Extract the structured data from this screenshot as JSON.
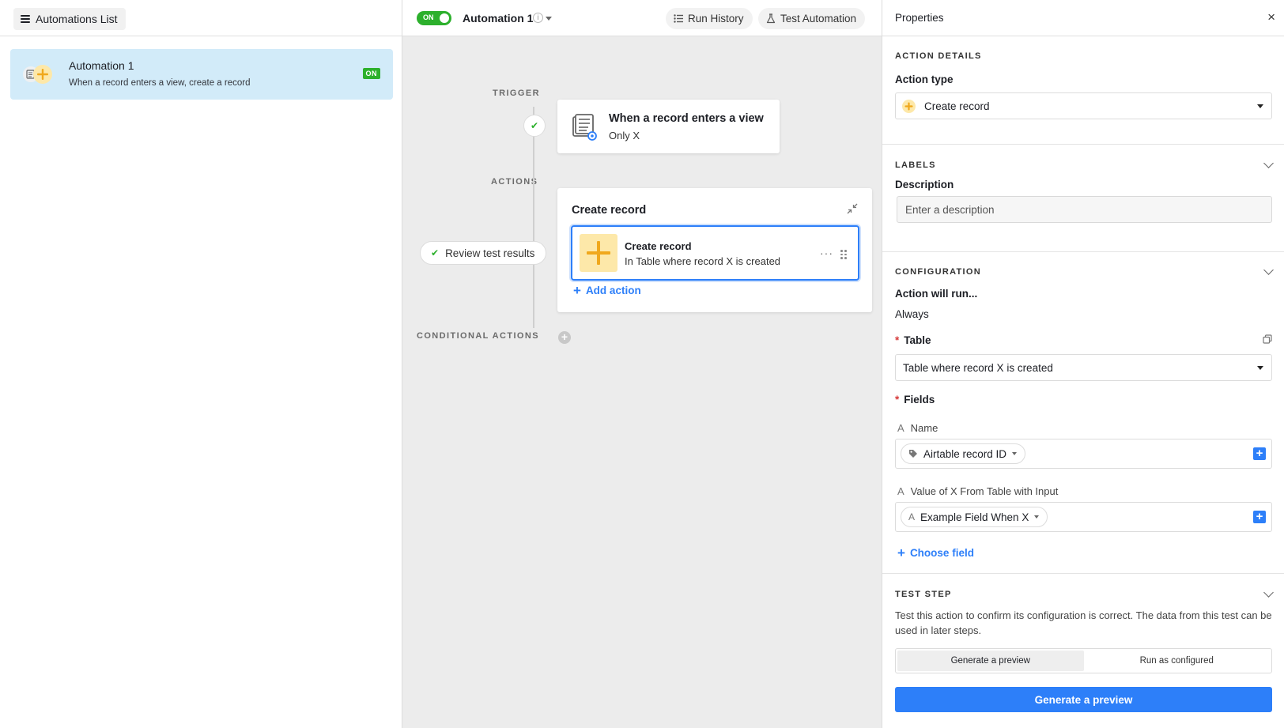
{
  "left": {
    "list_button": "Automations List",
    "automations": [
      {
        "name": "Automation 1",
        "description": "When a record enters a view, create a record",
        "status": "ON"
      }
    ]
  },
  "toolbar": {
    "toggle_label": "ON",
    "automation_name": "Automation 1",
    "info_glyph": "i",
    "run_history": "Run History",
    "test_automation": "Test Automation"
  },
  "canvas": {
    "trigger_label": "TRIGGER",
    "actions_label": "ACTIONS",
    "conditional_label": "CONDITIONAL ACTIONS",
    "trigger": {
      "title": "When a record enters a view",
      "subtitle": "Only X",
      "icon": "table-view-icon"
    },
    "review_pill": "Review test results",
    "actions_title": "Create record",
    "action_item": {
      "title": "Create record",
      "subtitle": "In Table where record X is created",
      "icon": "plus-icon",
      "menu": "···"
    },
    "add_action": "Add action"
  },
  "properties": {
    "title": "Properties",
    "close": "×",
    "action_details": {
      "heading": "ACTION DETAILS",
      "action_type_label": "Action type",
      "action_type_value": "Create record"
    },
    "labels": {
      "heading": "LABELS",
      "description_label": "Description",
      "description_placeholder": "Enter a description",
      "description_value": ""
    },
    "configuration": {
      "heading": "CONFIGURATION",
      "will_run_label": "Action will run...",
      "will_run_value": "Always",
      "table_label": "Table",
      "table_value": "Table where record X is created",
      "fields_label": "Fields",
      "fields": [
        {
          "type_glyph": "A",
          "name": "Name",
          "chip": "Airtable record ID",
          "chip_icon": "tag-icon"
        },
        {
          "type_glyph": "A",
          "name": "Value of X From Table with Input",
          "chip": "Example Field When X",
          "chip_icon": "text-field-icon",
          "chip_glyph": "A"
        }
      ],
      "choose_field": "Choose field"
    },
    "test_step": {
      "heading": "TEST STEP",
      "description": "Test this action to confirm its configuration is correct. The data from this test can be used in later steps.",
      "tabs": [
        "Generate a preview",
        "Run as configured"
      ],
      "active_tab": "Generate a preview",
      "button": "Generate a preview"
    }
  },
  "colors": {
    "accent": "#2d7ff9",
    "success": "#2cb02c",
    "selected_bg": "#d2ebf9",
    "action_icon_bg": "#fde8a9",
    "plus_color": "#f0a81c"
  }
}
